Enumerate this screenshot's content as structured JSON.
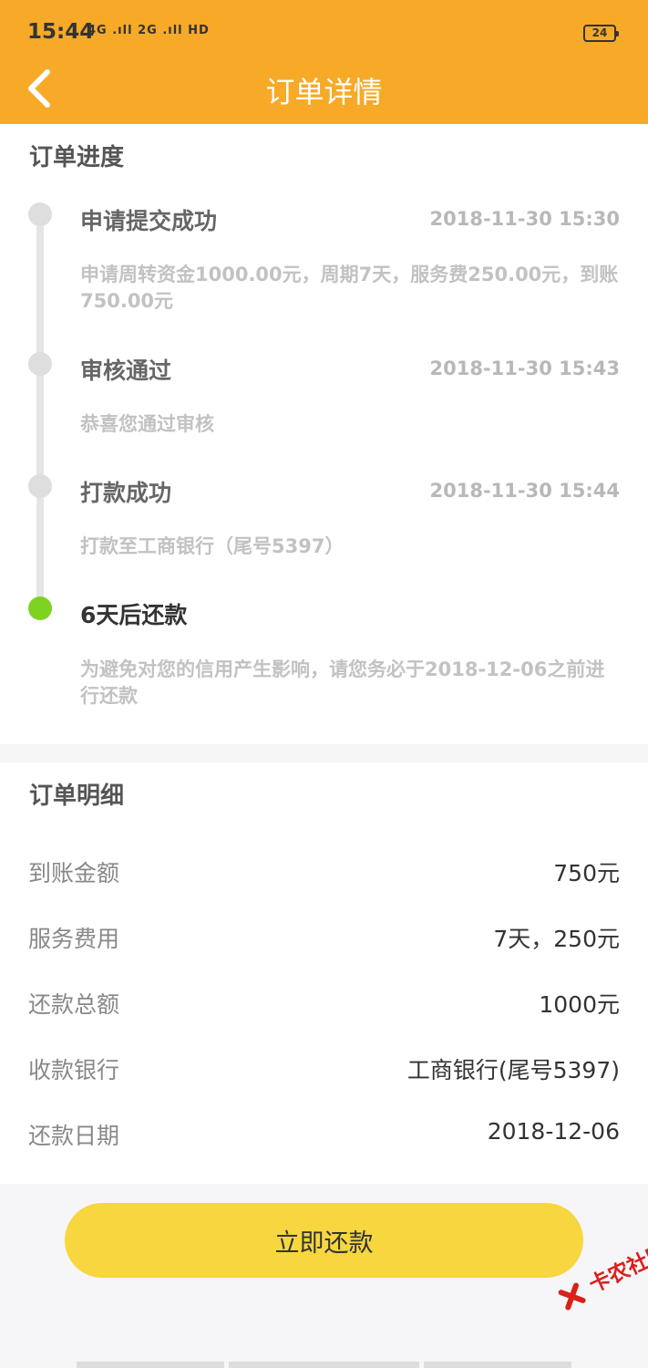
{
  "status": {
    "time": "15:44",
    "signal": "4G .ıll 2G .ıll HD",
    "battery": "24"
  },
  "header": {
    "title": "订单详情"
  },
  "progress": {
    "section_title": "订单进度",
    "steps": [
      {
        "title": "申请提交成功",
        "time": "2018-11-30 15:30",
        "description": "申请周转资金1000.00元，周期7天，服务费250.00元，到账750.00元"
      },
      {
        "title": "审核通过",
        "time": "2018-11-30 15:43",
        "description": "恭喜您通过审核"
      },
      {
        "title": "打款成功",
        "time": "2018-11-30 15:44",
        "description": "打款至工商银行（尾号5397）"
      },
      {
        "title": "6天后还款",
        "time": "",
        "description": "为避免对您的信用产生影响，请您务必于2018-12-06之前进行还款"
      }
    ]
  },
  "details": {
    "section_title": "订单明细",
    "rows": [
      {
        "label": "到账金额",
        "value": "750元"
      },
      {
        "label": "服务费用",
        "value": "7天，250元"
      },
      {
        "label": "还款总额",
        "value": "1000元"
      },
      {
        "label": "收款银行",
        "value": "工商银行(尾号5397)"
      },
      {
        "label": "还款日期",
        "value": "2018-12-06"
      }
    ]
  },
  "actions": {
    "pay_label": "立即还款"
  },
  "watermark": {
    "text": "卡农社区"
  },
  "colors": {
    "header": "#f7a928",
    "button": "#f7d640",
    "active_step": "#7ed321",
    "watermark": "#d8211b"
  }
}
